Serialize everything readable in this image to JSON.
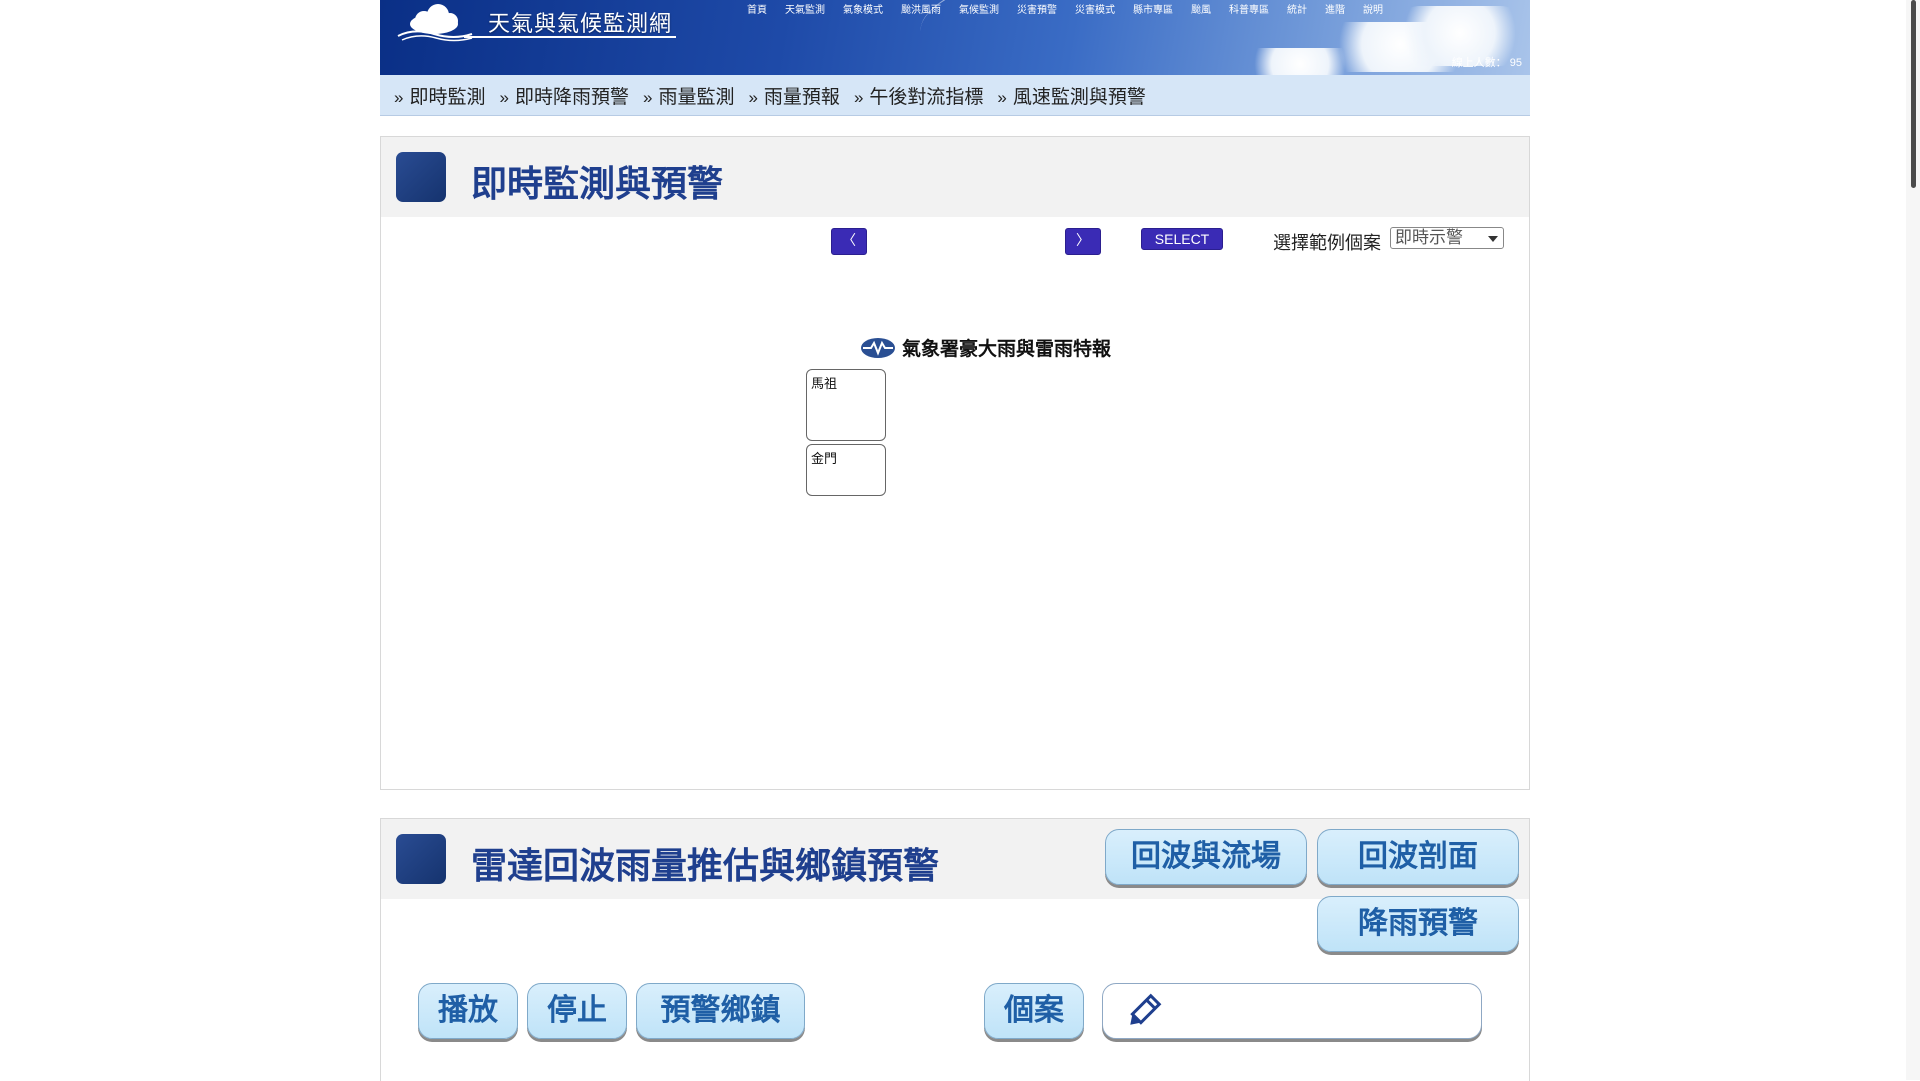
{
  "header": {
    "site_title": "天氣與氣候監測網",
    "nav": [
      "首頁",
      "天氣監測",
      "氣象模式",
      "颱洪風雨",
      "氣候監測",
      "災害預警",
      "災害模式",
      "縣市專區",
      "颱風",
      "科普專區",
      "統計",
      "進階",
      "說明"
    ],
    "online_label": "線上人數：",
    "online_count": "95"
  },
  "sub_nav": [
    "即時監測",
    "即時降雨預警",
    "雨量監測",
    "雨量預報",
    "午後對流指標",
    "風速監測與預警"
  ],
  "sub_nav_marker": "»",
  "panel1": {
    "title": "即時監測與預警",
    "prev_label": "〈",
    "next_label": "〉",
    "select_label": "SELECT",
    "case_label": "選擇範例個案",
    "case_value": "即時示警",
    "warning_title": "氣象署豪大雨與雷雨特報",
    "regions": [
      "馬祖",
      "金門"
    ]
  },
  "panel2": {
    "title": "雷達回波雨量推估與鄉鎮預警",
    "buttons": {
      "echo_flow": "回波與流場",
      "echo_profile": "回波剖面",
      "rain_warning": "降雨預警",
      "play": "播放",
      "stop": "停止",
      "warn_town": "預警鄉鎮",
      "case": "個案"
    }
  },
  "colors": {
    "banner": "#1e4aa8",
    "subnav_bg": "#d6e6f7",
    "title_blue": "#1f3f8e",
    "nav_button": "#3a2bb5",
    "pill_bg": "#bfe3f8"
  },
  "icons": [
    "cloud-logo-icon",
    "cwb-logo-icon",
    "pencil-icon"
  ]
}
